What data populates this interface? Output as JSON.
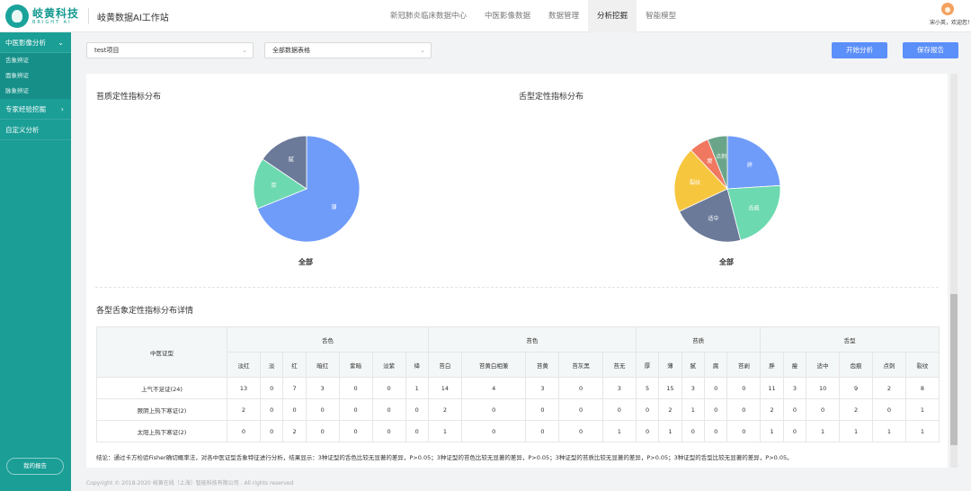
{
  "header": {
    "logo_cn": "岐黄科技",
    "logo_en": "BRIGHT AI",
    "app_title": "岐黄数据AI工作站",
    "nav": [
      "新冠肺炎临床数据中心",
      "中医影像数据",
      "数据管理",
      "分析挖掘",
      "智能模型"
    ],
    "active_nav": "分析挖掘",
    "user_greeting": "宋小英，欢迎您！"
  },
  "sidebar": {
    "groups": [
      {
        "label": "中医影像分析",
        "chevron": "down",
        "items": [
          "舌象辨证",
          "面象辨证",
          "脉象辨证"
        ]
      },
      {
        "label": "专家经验挖掘",
        "chevron": "right",
        "items": []
      },
      {
        "label": "自定义分析",
        "chevron": "",
        "items": []
      }
    ],
    "report_button": "我的报告"
  },
  "toolbar": {
    "project_select": "test项目",
    "table_select": "全部数据表格",
    "start_button": "开始分析",
    "save_button": "保存报告"
  },
  "charts": {
    "left": {
      "title": "苔质定性指标分布",
      "caption": "全部",
      "slices": [
        {
          "label": "薄",
          "value": 31,
          "color": "#6f9cf9"
        },
        {
          "label": "厚",
          "value": 7,
          "color": "#6dd9b0"
        },
        {
          "label": "腻",
          "value": 7,
          "color": "#6b7a99"
        }
      ]
    },
    "right": {
      "title": "舌型定性指标分布",
      "caption": "全部",
      "slices": [
        {
          "label": "胖",
          "value": 12,
          "color": "#6f9cf9"
        },
        {
          "label": "齿痕",
          "value": 11,
          "color": "#6dd9b0"
        },
        {
          "label": "适中",
          "value": 11,
          "color": "#6b7a99"
        },
        {
          "label": "裂纹",
          "value": 10,
          "color": "#f7c63f"
        },
        {
          "label": "瘦",
          "value": 3,
          "color": "#f07860"
        },
        {
          "label": "点刺",
          "value": 3,
          "color": "#6aa58a"
        }
      ]
    }
  },
  "table": {
    "title": "各型舌象定性指标分布详情",
    "row_header": "中医证型",
    "groups": [
      {
        "name": "舌色",
        "cols": [
          "淡红",
          "淡",
          "红",
          "暗红",
          "紫暗",
          "淡紫",
          "绛"
        ]
      },
      {
        "name": "苔色",
        "cols": [
          "苔白",
          "苔黄白相兼",
          "苔黄",
          "苔灰黑",
          "苔无"
        ]
      },
      {
        "name": "苔质",
        "cols": [
          "厚",
          "薄",
          "腻",
          "腐",
          "苔剥"
        ]
      },
      {
        "name": "舌型",
        "cols": [
          "胖",
          "瘦",
          "适中",
          "齿痕",
          "点刺",
          "裂纹"
        ]
      }
    ],
    "rows": [
      {
        "label": "上气不足证(24)",
        "values": [
          "13",
          "0",
          "7",
          "3",
          "0",
          "0",
          "1",
          "14",
          "4",
          "3",
          "0",
          "3",
          "5",
          "15",
          "3",
          "0",
          "0",
          "11",
          "3",
          "10",
          "9",
          "2",
          "8"
        ]
      },
      {
        "label": "厥阴上热下寒证(2)",
        "values": [
          "2",
          "0",
          "0",
          "0",
          "0",
          "0",
          "0",
          "2",
          "0",
          "0",
          "0",
          "0",
          "0",
          "2",
          "1",
          "0",
          "0",
          "2",
          "0",
          "0",
          "2",
          "0",
          "1"
        ]
      },
      {
        "label": "太阳上热下寒证(2)",
        "values": [
          "0",
          "0",
          "2",
          "0",
          "0",
          "0",
          "0",
          "1",
          "0",
          "0",
          "0",
          "1",
          "0",
          "1",
          "0",
          "0",
          "0",
          "1",
          "0",
          "1",
          "1",
          "1",
          "1"
        ]
      }
    ],
    "conclusion": "结论：通过卡方检验Fisher确切概率法，对各中医证型舌象特征进行分析，结果显示：3种证型的舌色比较无显著的差异，P>0.05；3种证型的苔色比较无显著的差异，P>0.05；3种证型的苔质比较无显著的差异，P>0.05；3种证型的舌型比较无显著的差异，P>0.05。"
  },
  "footer": "Copyright © 2018-2020 岐黄在线（上海）智能科技有限公司 . All rights reserved"
}
